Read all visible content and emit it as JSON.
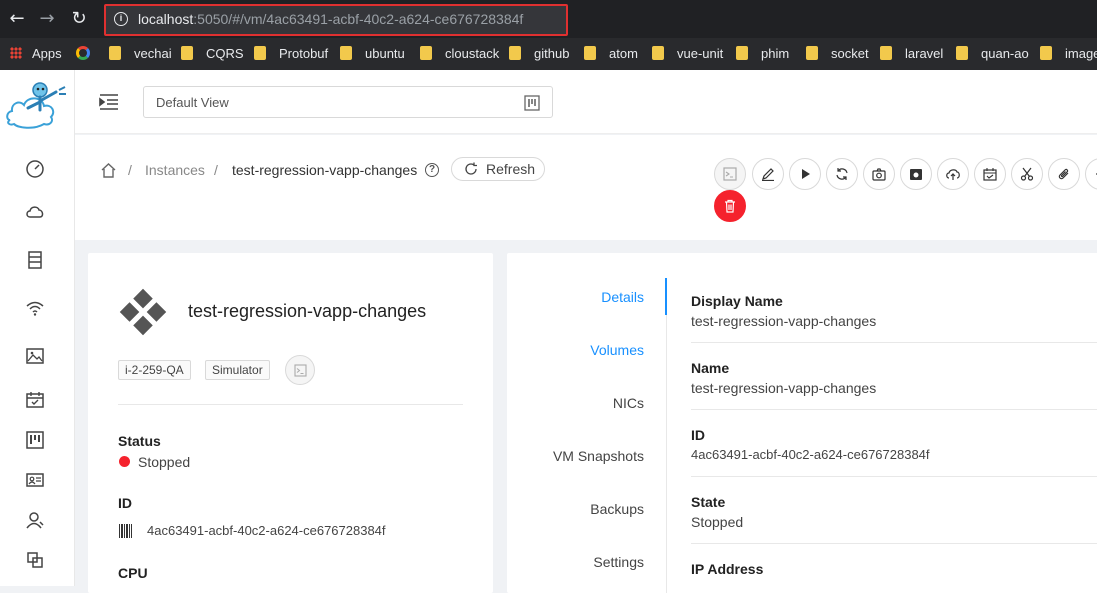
{
  "browser": {
    "url_host": "localhost",
    "url_path": ":5050/#/vm/4ac63491-acbf-40c2-a624-ce676728384f",
    "bookmarks": [
      "Apps",
      "vechai",
      "CQRS",
      "Protobuf",
      "ubuntu",
      "cloustack",
      "github",
      "atom",
      "vue-unit",
      "phim",
      "socket",
      "laravel",
      "quan-ao",
      "image"
    ]
  },
  "header": {
    "view_select": "Default View"
  },
  "breadcrumb": {
    "section": "Instances",
    "current": "test-regression-vapp-changes",
    "separator": "/"
  },
  "refresh_label": "Refresh",
  "vm": {
    "name": "test-regression-vapp-changes",
    "tags": [
      "i-2-259-QA",
      "Simulator"
    ],
    "status_label": "Status",
    "status_value": "Stopped",
    "id_label": "ID",
    "id_value": "4ac63491-acbf-40c2-a624-ce676728384f",
    "cpu_label": "CPU"
  },
  "tabs": [
    "Details",
    "Volumes",
    "NICs",
    "VM Snapshots",
    "Backups",
    "Settings"
  ],
  "details": [
    {
      "key": "Display Name",
      "value": "test-regression-vapp-changes"
    },
    {
      "key": "Name",
      "value": "test-regression-vapp-changes"
    },
    {
      "key": "ID",
      "value": "4ac63491-acbf-40c2-a624-ce676728384f"
    },
    {
      "key": "State",
      "value": "Stopped"
    },
    {
      "key": "IP Address",
      "value": ""
    }
  ],
  "colors": {
    "accent": "#1890ff",
    "danger": "#f5222d",
    "highlight_box": "#e03030"
  }
}
